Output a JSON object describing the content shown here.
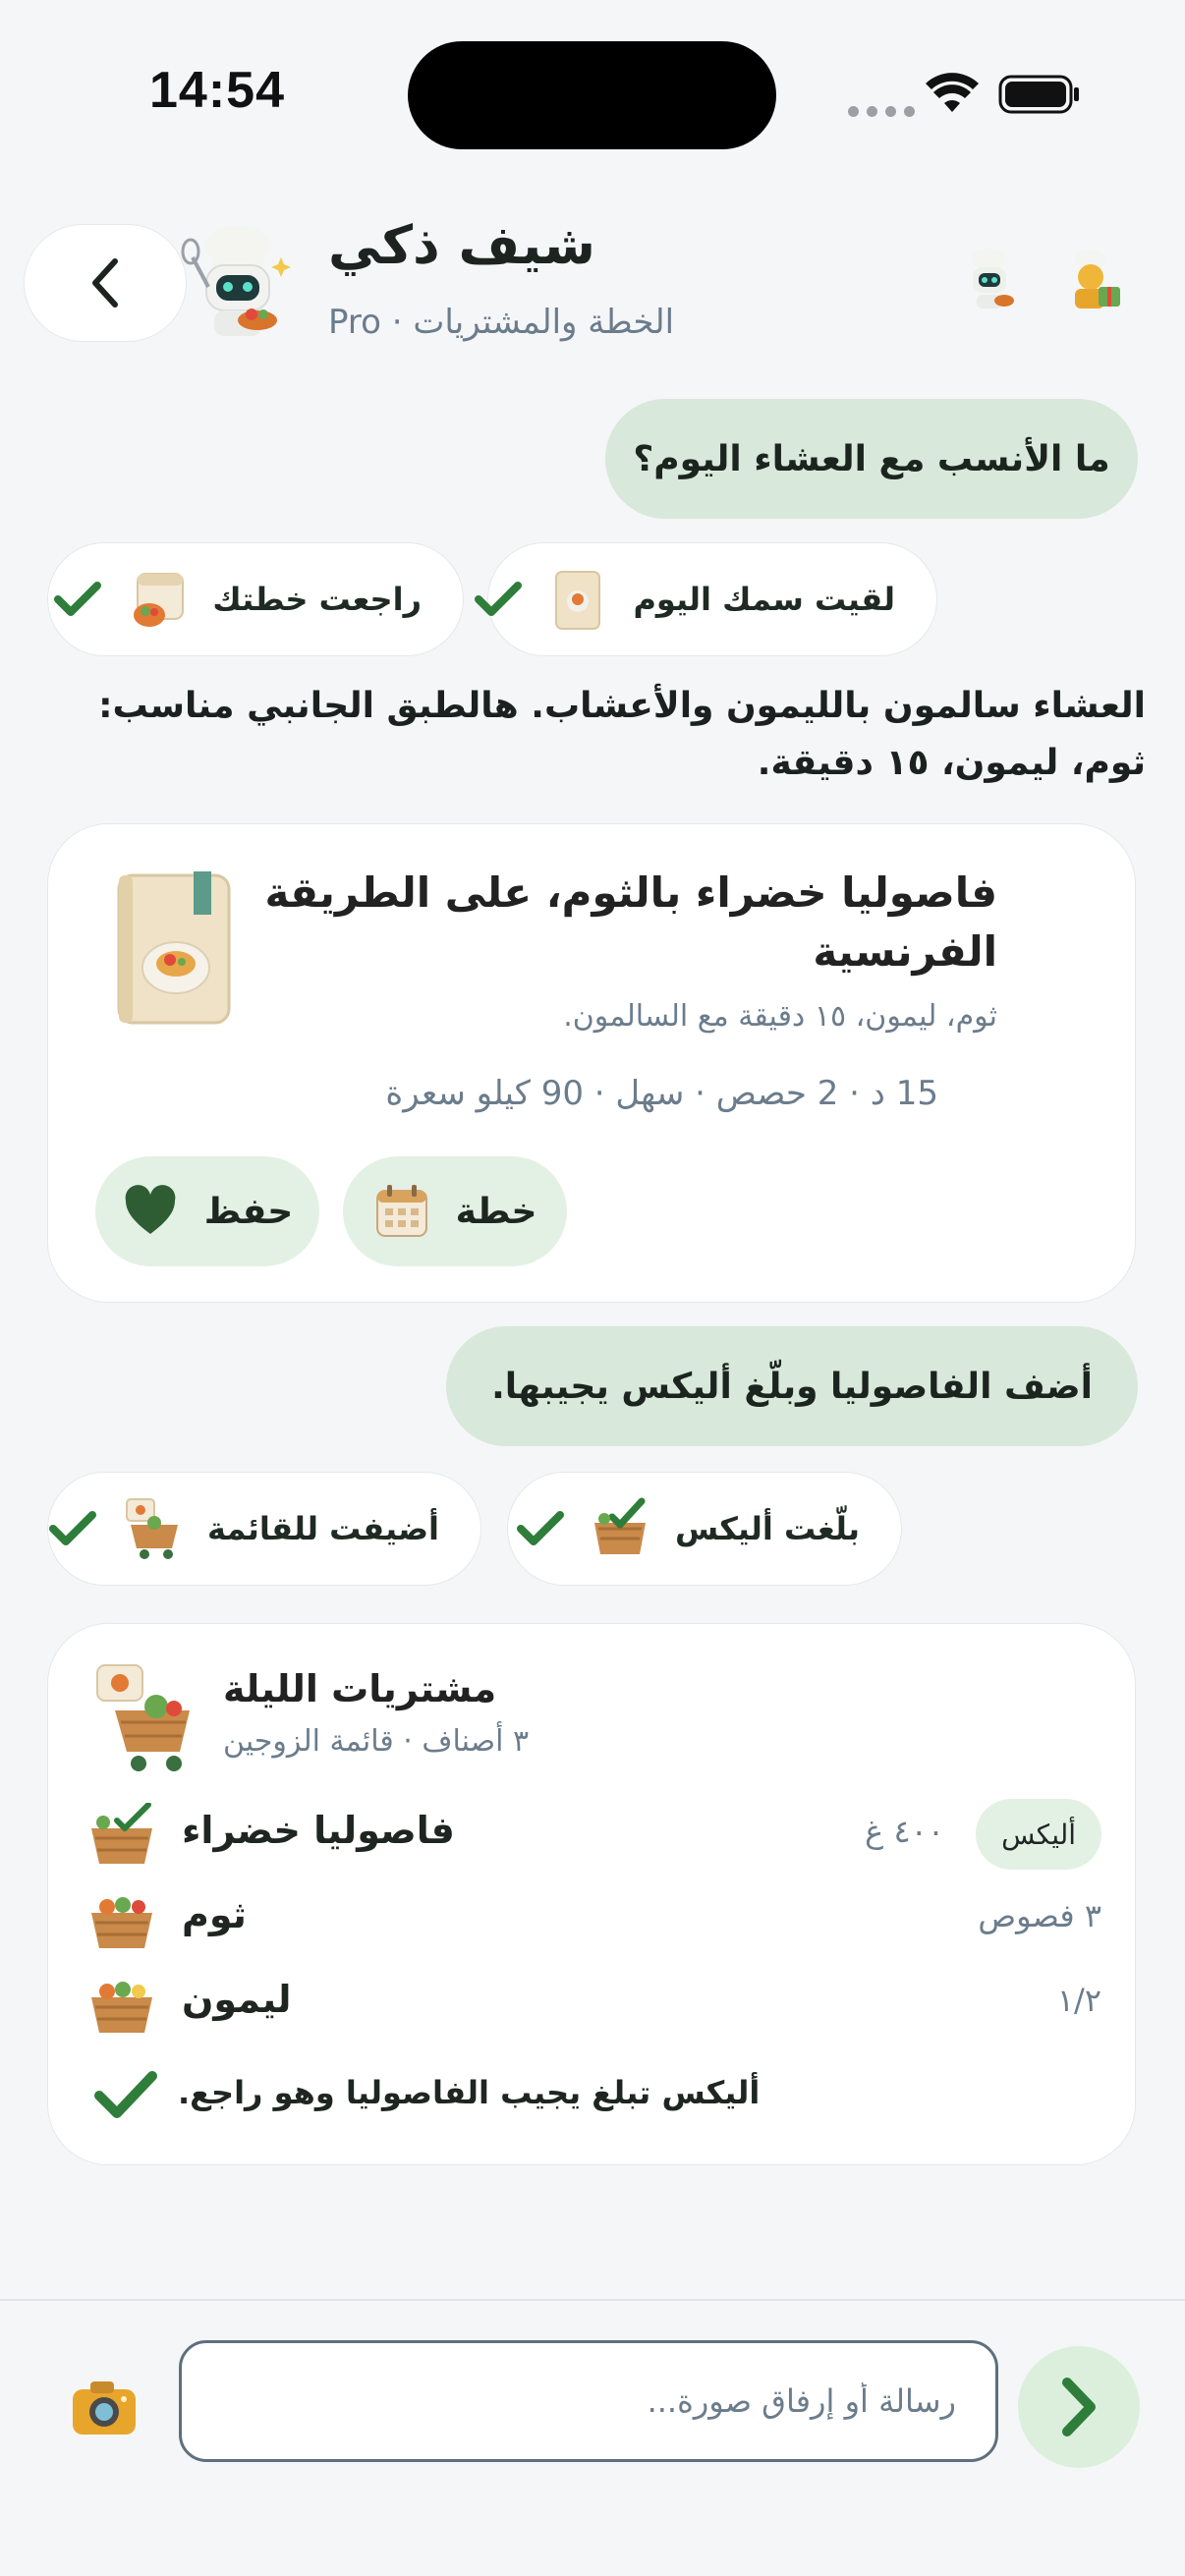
{
  "status_bar": {
    "time": "14:54"
  },
  "header": {
    "title": "شيف ذكي",
    "subtitle": "الخطة والمشتريات · Pro",
    "back_icon": "chevron-left-icon",
    "avatar_icon": "chef-robot-icon",
    "right_icons": [
      "chef-robot-icon",
      "chef-gift-icon"
    ]
  },
  "messages": {
    "user_1": "ما الأنسب مع العشاء اليوم؟",
    "chips_1": [
      {
        "label": "لقيت سمك اليوم",
        "icon": "recipe-book-icon"
      },
      {
        "label": "راجعت خطتك",
        "icon": "calendar-plan-icon"
      }
    ],
    "assistant_text": "العشاء سالمون بالليمون والأعشاب. هالطبق الجانبي مناسب: ثوم، ليمون، ١٥ دقيقة.",
    "recipe": {
      "title": "فاصوليا خضراء بالثوم، على الطريقة الفرنسية",
      "description": "ثوم، ليمون، ١٥ دقيقة مع السالمون.",
      "meta": "15 د  ·  2 حصص  ·  سهل  ·  90 كيلو سعرة",
      "save_label": "حفظ",
      "plan_label": "خطة"
    },
    "user_2": "أضف الفاصوليا وبلّغ أليكس يجيبها.",
    "chips_2": [
      {
        "label": "بلّغت أليكس",
        "icon": "basket-check-icon"
      },
      {
        "label": "أضيفت للقائمة",
        "icon": "cart-list-icon"
      }
    ],
    "shopping": {
      "title": "مشتريات الليلة",
      "subtitle": "٣ أصناف  ·  قائمة الزوجين",
      "items": [
        {
          "name": "فاصوليا خضراء",
          "qty": "٤٠٠ غ",
          "assignee": "أليكس"
        },
        {
          "name": "ثوم",
          "qty": "٣ فصوص"
        },
        {
          "name": "ليمون",
          "qty": "١/٢"
        }
      ],
      "note": "أليكس تبلغ يجيب الفاصوليا وهو راجع."
    }
  },
  "composer": {
    "placeholder": "رسالة أو إرفاق صورة..."
  },
  "colors": {
    "accent_green": "#2f7d3a",
    "bubble_green": "#d8e8da",
    "pill_green": "#e3f1e5",
    "muted_text": "#6b7c8c"
  }
}
